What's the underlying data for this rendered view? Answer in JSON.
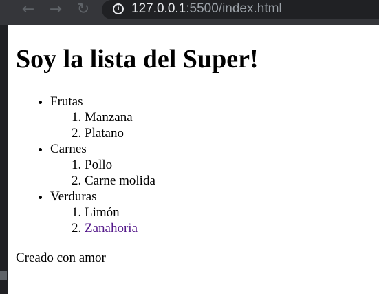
{
  "browser": {
    "back_icon": "arrow-left-icon",
    "forward_icon": "arrow-right-icon",
    "reload_icon": "reload-icon",
    "info_icon": "info-icon",
    "url_host": "127.0.0.1",
    "url_rest": ":5500/index.html"
  },
  "page": {
    "title": "Soy la lista del Super!",
    "categories": [
      {
        "name": "Frutas",
        "items": [
          "Manzana",
          "Platano"
        ]
      },
      {
        "name": "Carnes",
        "items": [
          "Pollo",
          "Carne molida"
        ]
      },
      {
        "name": "Verduras",
        "items": [
          "Limón",
          "Zanahoria"
        ]
      }
    ],
    "footer": "Creado con amor"
  },
  "colors": {
    "visited_link": "#551a8b",
    "page_background": "#ffffff",
    "chrome_background": "#35363a",
    "omnibox_background": "#202124"
  }
}
